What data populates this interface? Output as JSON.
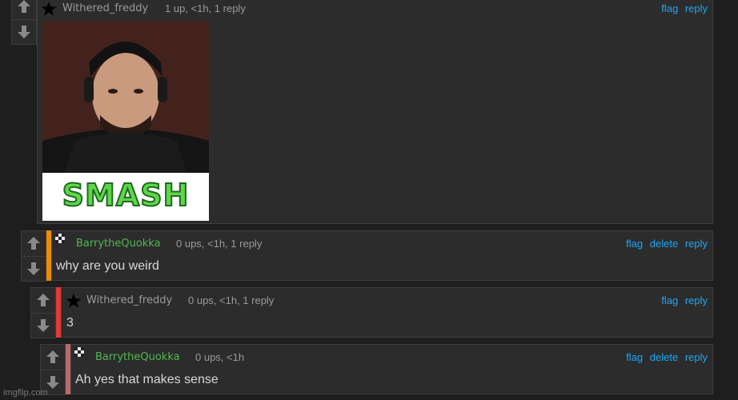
{
  "comments": [
    {
      "username": "Withered_freddy",
      "meta": "1 up, <1h, 1 reply",
      "actions": [
        "flag",
        "reply"
      ],
      "badge": "star-icon",
      "image_caption": "SMASH",
      "bar_color": ""
    },
    {
      "username": "BarrytheQuokka",
      "meta": "0 ups, <1h, 1 reply",
      "actions": [
        "flag",
        "delete",
        "reply"
      ],
      "badge": "checker-icon",
      "text": "why are you weird",
      "bar_color": "#f08a00"
    },
    {
      "username": "Withered_freddy",
      "meta": "0 ups, <1h, 1 reply",
      "actions": [
        "flag",
        "reply"
      ],
      "badge": "star-icon",
      "text": "3",
      "bar_color": "#e23a3a"
    },
    {
      "username": "BarrytheQuokka",
      "meta": "0 ups, <1h",
      "actions": [
        "flag",
        "delete",
        "reply"
      ],
      "badge": "checker-icon",
      "text": "Ah yes that makes sense",
      "bar_color": "#b86a6a"
    }
  ],
  "watermark": "imgflip.com",
  "colors": {
    "link": "#1ea7f3",
    "username_green": "#4fb84f"
  }
}
